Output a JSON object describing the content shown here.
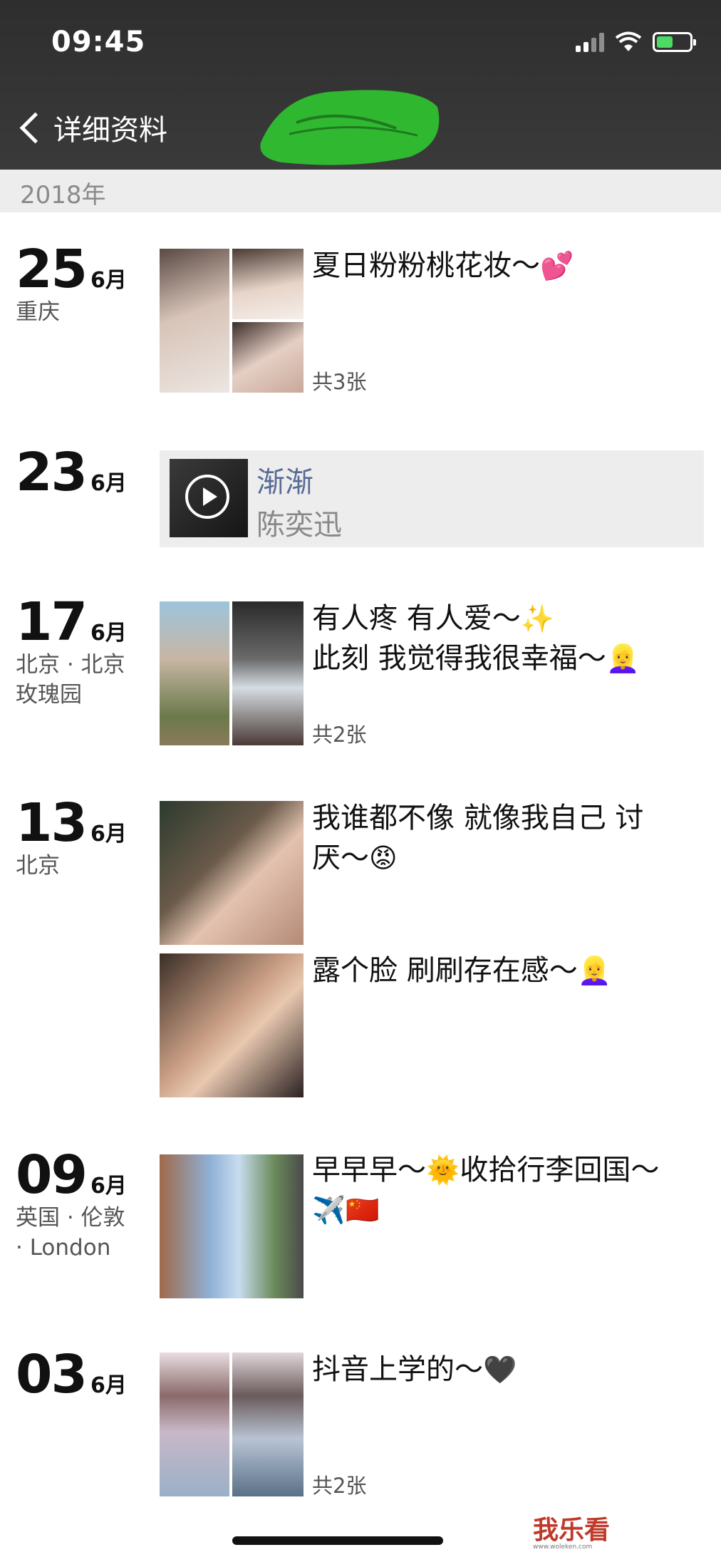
{
  "status_bar": {
    "time": "09:45"
  },
  "nav": {
    "back_label": "详细资料"
  },
  "year_label": "2018年",
  "posts": [
    {
      "day": "25",
      "month": "6月",
      "location": "重庆",
      "caption": "夏日粉粉桃花妆～",
      "emoji": "💕",
      "count": "共3张"
    },
    {
      "day": "23",
      "month": "6月",
      "location": "",
      "music_title": "渐渐",
      "music_artist": "陈奕迅"
    },
    {
      "day": "17",
      "month": "6月",
      "location_line1": "北京 · 北京",
      "location_line2": "玫瑰园",
      "caption_line1": "有人疼 有人爱～",
      "emoji1": "✨",
      "caption_line2": "此刻 我觉得我很幸福～",
      "emoji2": "👱‍♀️",
      "count": "共2张"
    },
    {
      "day": "13",
      "month": "6月",
      "location": "北京",
      "caption_line1": "我谁都不像 就像我自己 讨",
      "caption_line2": "厌～",
      "emoji": "😡",
      "caption2": "露个脸 刷刷存在感～",
      "emoji2": "👱‍♀️"
    },
    {
      "day": "09",
      "month": "6月",
      "location_line1": "英国 · 伦敦",
      "location_line2": "· London",
      "caption_line1": "早早早～",
      "emoji1": "🌞",
      "caption_mid": "收拾行李回国～",
      "emoji2": "✈️",
      "emoji3": "🇨🇳"
    },
    {
      "day": "03",
      "month": "6月",
      "location": "",
      "caption": "抖音上学的～",
      "emoji": "🖤",
      "count": "共2张"
    }
  ],
  "watermark": {
    "text": "我乐看",
    "url": "www.woleken.com"
  }
}
